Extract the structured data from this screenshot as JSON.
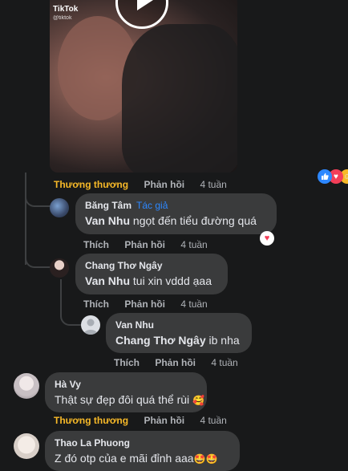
{
  "top_comment": {
    "media": {
      "watermark": "TikTok",
      "watermark_sub": "@tiktok"
    },
    "actions": {
      "reaction": "Thương thương",
      "reply": "Phản hồi",
      "time": "4 tuần"
    },
    "reaction_icons": [
      "like-icon",
      "love-icon",
      "care-icon"
    ]
  },
  "replies": [
    {
      "author": "Băng Tâm",
      "badge": "Tác giả",
      "mention": "Van Nhu",
      "text": " ngọt đến tiểu đường quá",
      "like": "Thích",
      "reply": "Phản hồi",
      "time": "4 tuần",
      "reaction_icon": "heart-icon"
    },
    {
      "author": "Chang Thơ Ngây",
      "mention": "Van Nhu",
      "text": " tui xin vddd ạaa",
      "like": "Thích",
      "reply": "Phản hồi",
      "time": "4 tuần"
    },
    {
      "author": "Van Nhu",
      "mention": "Chang Thơ Ngây",
      "text": " ib nha",
      "like": "Thích",
      "reply": "Phản hồi",
      "time": "4 tuần"
    }
  ],
  "comments": [
    {
      "author": "Hà Vy",
      "text": "Thật sự đẹp đôi quá thể rùi",
      "emoji": "🥰",
      "reaction": "Thương thương",
      "reply": "Phản hồi",
      "time": "4 tuần"
    },
    {
      "author": "Thao La Phuong",
      "text": "Z đó otp của e mãi đỉnh aaa",
      "emoji": "🤩🤩"
    }
  ],
  "colors": {
    "background": "#18191a",
    "bubble": "#3a3b3c",
    "accent_blue": "#2d88ff",
    "love_yellow": "#f7b928"
  }
}
